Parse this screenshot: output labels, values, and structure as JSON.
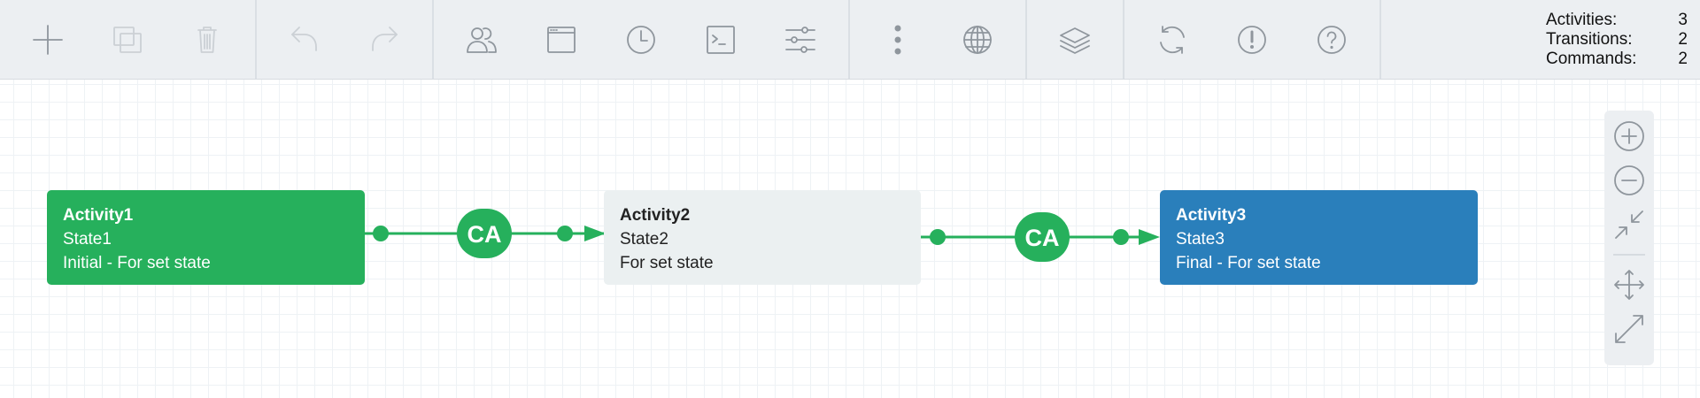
{
  "toolbar": {
    "groups": [
      [
        "add-icon",
        "copy-icon",
        "trash-icon"
      ],
      [
        "undo-icon",
        "redo-icon"
      ],
      [
        "users-icon",
        "window-icon",
        "clock-icon",
        "terminal-icon",
        "sliders-icon"
      ],
      [
        "more-vertical-icon",
        "globe-icon"
      ],
      [
        "layers-icon"
      ],
      [
        "refresh-icon",
        "alert-icon",
        "help-icon"
      ]
    ],
    "disabled": [
      "copy-icon",
      "trash-icon",
      "undo-icon",
      "redo-icon"
    ]
  },
  "stats": {
    "activities_label": "Activities:",
    "activities_value": "3",
    "transitions_label": "Transitions:",
    "transitions_value": "2",
    "commands_label": "Commands:",
    "commands_value": "2"
  },
  "activities": [
    {
      "name": "Activity1",
      "state": "State1",
      "desc": "Initial - For set state",
      "kind": "initial"
    },
    {
      "name": "Activity2",
      "state": "State2",
      "desc": "For set state",
      "kind": "middle"
    },
    {
      "name": "Activity3",
      "state": "State3",
      "desc": "Final - For set state",
      "kind": "final"
    }
  ],
  "transitions": [
    {
      "label": "CA"
    },
    {
      "label": "CA"
    }
  ],
  "colors": {
    "initial": "#26b05c",
    "middle": "#ebf0f1",
    "final": "#2a7fbb",
    "transition": "#26b05c",
    "icon": "#8f969d"
  },
  "zoom_panel": [
    "zoom-in-icon",
    "zoom-out-icon",
    "fit-icon",
    "move-icon",
    "expand-icon"
  ]
}
